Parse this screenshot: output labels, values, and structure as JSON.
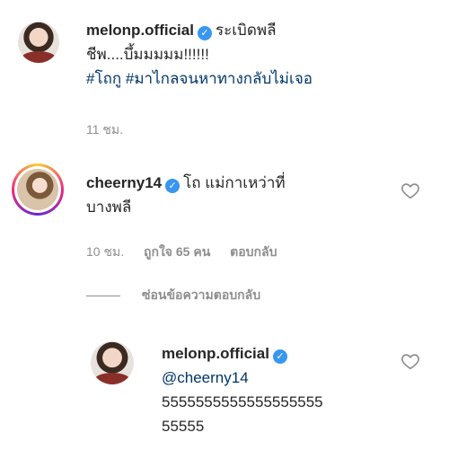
{
  "comments": [
    {
      "username": "melonp.official",
      "text_line1": "ระเบิดพลี",
      "text_line2": "ชีพ....บึ้มมมมม!!!!!!",
      "hashtags": "#โถกู #มาไกลจนหาทางกลับไม่เจอ",
      "time": "11 ชม."
    },
    {
      "username": "cheerny14",
      "text_line1": "โถ แม่กาเหว่าที่",
      "text_line2": "บางพลี",
      "time": "10 ชม.",
      "likes": "ถูกใจ 65 คน",
      "reply_label": "ตอบกลับ"
    }
  ],
  "replies_toggle": "ซ่อนข้อความตอบกลับ",
  "reply": {
    "username": "melonp.official",
    "mention": "@cheerny14",
    "text_line1": "5555555555555555555",
    "text_line2": "55555"
  },
  "icons": {
    "verified": "verified-badge-icon",
    "heart": "heart-outline-icon"
  },
  "colors": {
    "verified": "#3897f0",
    "hashtag": "#003569",
    "meta": "#8e8e8e"
  }
}
